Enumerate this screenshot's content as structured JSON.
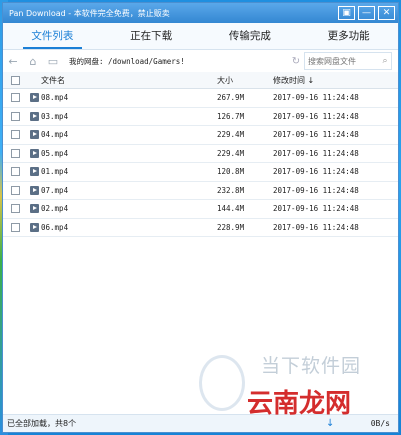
{
  "window": {
    "title": "Pan Download - 本软件完全免费，禁止贩卖"
  },
  "titlebar_buttons": [
    "▣",
    "—",
    "✕"
  ],
  "tabs": [
    {
      "label": "文件列表",
      "active": true
    },
    {
      "label": "正在下载",
      "active": false
    },
    {
      "label": "传输完成",
      "active": false
    },
    {
      "label": "更多功能",
      "active": false
    }
  ],
  "pathbar": {
    "path": "我的网盘: /download/Gamers!",
    "search_placeholder": "搜索网盘文件"
  },
  "columns": {
    "name": "文件名",
    "size": "大小",
    "date": "修改时间 ↓"
  },
  "files": [
    {
      "name": "08.mp4",
      "size": "267.9M",
      "date": "2017-09-16 11:24:48"
    },
    {
      "name": "03.mp4",
      "size": "126.7M",
      "date": "2017-09-16 11:24:48"
    },
    {
      "name": "04.mp4",
      "size": "229.4M",
      "date": "2017-09-16 11:24:48"
    },
    {
      "name": "05.mp4",
      "size": "229.4M",
      "date": "2017-09-16 11:24:48"
    },
    {
      "name": "01.mp4",
      "size": "120.8M",
      "date": "2017-09-16 11:24:48"
    },
    {
      "name": "07.mp4",
      "size": "232.8M",
      "date": "2017-09-16 11:24:48"
    },
    {
      "name": "02.mp4",
      "size": "144.4M",
      "date": "2017-09-16 11:24:48"
    },
    {
      "name": "06.mp4",
      "size": "228.9M",
      "date": "2017-09-16 11:24:48"
    }
  ],
  "status": {
    "text": "已全部加载，共8个",
    "speed": "0B/s"
  },
  "watermark": {
    "line1": "当下软件园",
    "line2": "云南龙网"
  },
  "colors": {
    "accent": "#1b7fd6",
    "titlebar": "#3a8dd6"
  }
}
